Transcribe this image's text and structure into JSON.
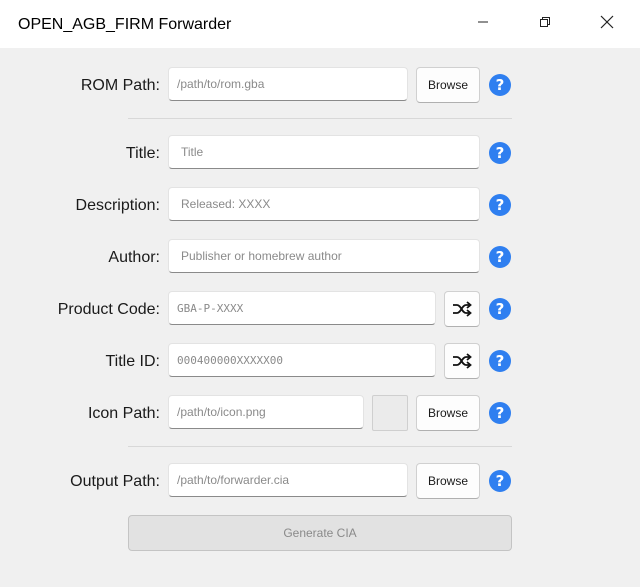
{
  "window": {
    "title": "OPEN_AGB_FIRM Forwarder",
    "minimize_icon": "minimize-icon",
    "restore_icon": "restore-icon",
    "close_icon": "close-icon"
  },
  "form": {
    "rom_path": {
      "label": "ROM Path:",
      "placeholder": "/path/to/rom.gba",
      "browse": "Browse"
    },
    "title": {
      "label": "Title:",
      "placeholder": "Title"
    },
    "description": {
      "label": "Description:",
      "placeholder": "Released: XXXX"
    },
    "author": {
      "label": "Author:",
      "placeholder": "Publisher or homebrew author"
    },
    "product_code": {
      "label": "Product Code:",
      "placeholder": "GBA-P-XXXX",
      "random_icon": "shuffle-icon"
    },
    "title_id": {
      "label": "Title ID:",
      "placeholder": "000400000XXXXX00",
      "random_icon": "shuffle-icon"
    },
    "icon_path": {
      "label": "Icon Path:",
      "placeholder": "/path/to/icon.png",
      "browse": "Browse"
    },
    "output_path": {
      "label": "Output Path:",
      "placeholder": "/path/to/forwarder.cia",
      "browse": "Browse"
    },
    "help_glyph": "?",
    "generate": "Generate CIA"
  },
  "colors": {
    "help_blue": "#2f7ff0",
    "background": "#f0f0f0",
    "titlebar": "#ffffff"
  }
}
